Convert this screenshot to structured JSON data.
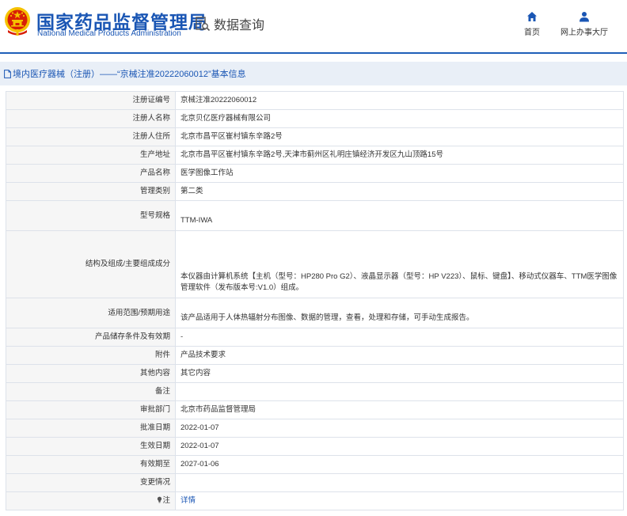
{
  "header": {
    "org_cn": "国家药品监督管理局",
    "org_en": "National Medical Products Administration",
    "query_label": "数据查询",
    "nav": {
      "home": "首页",
      "online": "网上办事大厅"
    }
  },
  "breadcrumb": "境内医疗器械（注册）——“京械注准20222060012”基本信息",
  "rows": [
    {
      "label": "注册证编号",
      "value": "京械注准20222060012"
    },
    {
      "label": "注册人名称",
      "value": "北京贝亿医疗器械有限公司"
    },
    {
      "label": "注册人住所",
      "value": "北京市昌平区崔村镇东辛路2号"
    },
    {
      "label": "生产地址",
      "value": "北京市昌平区崔村镇东辛路2号,天津市蓟州区礼明庄镇经济开发区九山顶路15号"
    },
    {
      "label": "产品名称",
      "value": "医学图像工作站"
    },
    {
      "label": "管理类别",
      "value": "第二类"
    },
    {
      "label": "型号规格",
      "value": "TTM-IWA"
    },
    {
      "label": "结构及组成/主要组成成分",
      "value": "本仪器由计算机系统【主机（型号：HP280 Pro G2）、液晶显示器（型号：HP V223）、鼠标、键盘】、移动式仪器车、TTM医学图像管理软件（发布版本号:V1.0）组成。"
    },
    {
      "label": "适用范围/预期用途",
      "value": "该产品适用于人体热辐射分布图像、数据的管理，查看，处理和存储，可手动生成报告。"
    },
    {
      "label": "产品储存条件及有效期",
      "value": "-"
    },
    {
      "label": "附件",
      "value": "产品技术要求"
    },
    {
      "label": "其他内容",
      "value": "其它内容"
    },
    {
      "label": "备注",
      "value": ""
    },
    {
      "label": "审批部门",
      "value": "北京市药品监督管理局"
    },
    {
      "label": "批准日期",
      "value": "2022-01-07"
    },
    {
      "label": "生效日期",
      "value": "2022-01-07"
    },
    {
      "label": "有效期至",
      "value": "2027-01-06"
    },
    {
      "label": "变更情况",
      "value": ""
    },
    {
      "label": "注",
      "value": "详情"
    }
  ],
  "colors": {
    "brand_blue": "#1a56b4",
    "breadcrumb_bg": "#e9eff7",
    "emblem_red": "#d81e06",
    "emblem_gold": "#f5c200"
  },
  "icons": {
    "emblem": "national-emblem-icon",
    "query": "document-search-icon",
    "home": "home-icon",
    "user": "user-icon",
    "doc": "document-icon",
    "bulb": "lightbulb-icon"
  }
}
